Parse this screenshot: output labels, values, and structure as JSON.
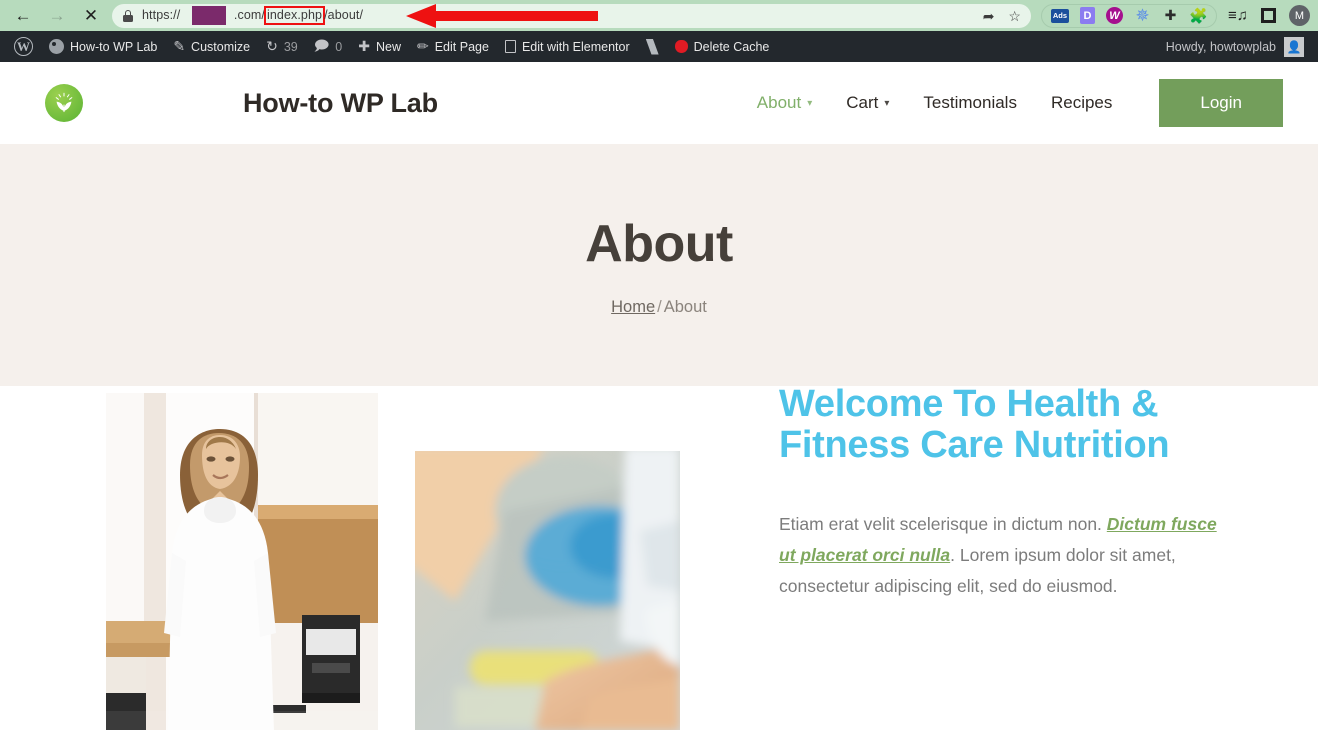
{
  "browser": {
    "nav": {
      "back_icon": "arrow-left-icon",
      "forward_icon": "arrow-right-icon",
      "stop_icon": "close-x-icon"
    },
    "omnibox": {
      "lock_icon": "lock-icon",
      "scheme": "https://",
      "redacted_domain": "",
      "tld": ".com/",
      "highlighted_segment": "index.php",
      "path_rest": "/about/",
      "share_icon": "share-icon",
      "bookmark_icon": "star-icon"
    },
    "extensions": [
      {
        "name": "ads-blocker-extension",
        "label": "Ads"
      },
      {
        "name": "d-extension",
        "label": "D"
      },
      {
        "name": "wordpress-extension",
        "label": "W"
      },
      {
        "name": "asterisk-extension",
        "label": "✳"
      },
      {
        "name": "grid-add-extension",
        "label": "⊹"
      },
      {
        "name": "puzzle-extensions-icon",
        "label": "🧩"
      }
    ],
    "toolbar_right": [
      {
        "name": "reading-list-icon",
        "label": "≡♪"
      },
      {
        "name": "side-panel-icon",
        "label": ""
      },
      {
        "name": "profile-avatar",
        "label": "M"
      }
    ],
    "annotation": {
      "arrow_color": "#ee1111",
      "highlight_box_color": "#ee1111"
    }
  },
  "wp_adminbar": {
    "logo": {
      "name": "wordpress-logo",
      "glyph": "W"
    },
    "items": [
      {
        "name": "site-name",
        "label": "How-to WP Lab",
        "icon": "dashboard-icon"
      },
      {
        "name": "customize",
        "label": "Customize",
        "icon": "paintbrush-icon"
      },
      {
        "name": "updates",
        "label": "39",
        "icon": "updates-icon"
      },
      {
        "name": "comments",
        "label": "0",
        "icon": "comment-bubble-icon"
      },
      {
        "name": "new-content",
        "label": "New",
        "icon": "plus-icon"
      },
      {
        "name": "edit-page",
        "label": "Edit Page",
        "icon": "pencil-icon"
      },
      {
        "name": "edit-with-elementor",
        "label": "Edit with Elementor",
        "icon": "elementor-icon"
      },
      {
        "name": "yoast-seo",
        "label": "",
        "icon": "yoast-icon"
      },
      {
        "name": "delete-cache",
        "label": "Delete Cache",
        "icon": "wp-rocket-icon"
      }
    ],
    "howdy": {
      "label": "Howdy, howtowplab",
      "avatar_icon": "user-avatar-icon"
    }
  },
  "site_header": {
    "logo_name": "leaf-sprout-logo",
    "title": "How-to WP Lab",
    "nav": [
      {
        "name": "nav-about",
        "label": "About",
        "has_caret": true,
        "active": true
      },
      {
        "name": "nav-cart",
        "label": "Cart",
        "has_caret": true,
        "active": false
      },
      {
        "name": "nav-testimonials",
        "label": "Testimonials",
        "has_caret": false,
        "active": false
      },
      {
        "name": "nav-recipes",
        "label": "Recipes",
        "has_caret": false,
        "active": false
      }
    ],
    "login_label": "Login",
    "login_bg": "#739e5b",
    "active_color": "#81b06a"
  },
  "hero": {
    "title": "About",
    "bg": "#f5f0ec",
    "breadcrumb": {
      "home_label": "Home",
      "separator": "/",
      "current_label": "About"
    }
  },
  "content": {
    "image_left_name": "woman-in-kitchen-photo",
    "image_right_name": "hands-with-notebook-photo",
    "heading": "Welcome To Health & Fitness Care Nutrition",
    "heading_color": "#4ec3e8",
    "paragraph_part1": "Etiam erat velit scelerisque in dictum non. ",
    "paragraph_link": "Dictum fusce ut placerat orci nulla",
    "paragraph_part2": ". Lorem ipsum dolor sit amet, consectetur adipiscing elit, sed do eiusmod.",
    "link_color": "#7fa85e"
  }
}
